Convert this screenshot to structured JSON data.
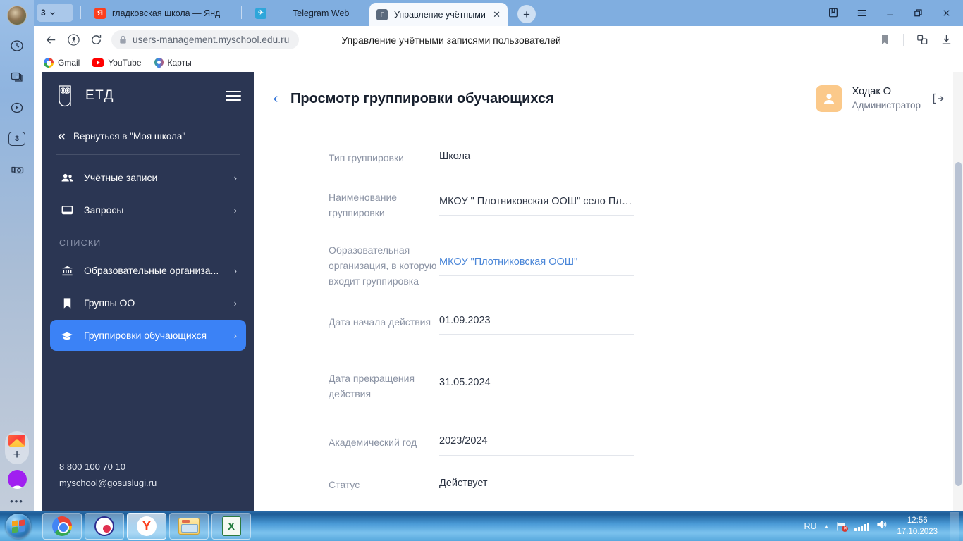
{
  "browser": {
    "tab_count": "3",
    "tabs": [
      {
        "id": "tab-yandex",
        "title": "гладковская школа — Янд",
        "favicon": "yandex-icon",
        "active": false
      },
      {
        "id": "tab-telegram",
        "title": "Telegram Web",
        "favicon": "telegram-icon",
        "active": false
      },
      {
        "id": "tab-gosuslugi",
        "title": "Управление учётными",
        "favicon": "gosuslugi-icon",
        "active": true
      }
    ],
    "new_tab_label": "+",
    "close_label": "✕",
    "address": "users-management.myschool.edu.ru",
    "document_title": "Управление учётными записями пользователей",
    "bookmarks": [
      {
        "label": "Gmail",
        "icon": "google-icon"
      },
      {
        "label": "YouTube",
        "icon": "youtube-icon"
      },
      {
        "label": "Карты",
        "icon": "maps-pin-icon"
      }
    ]
  },
  "sidepanel": {
    "items": [
      {
        "icon": "profile-avatar"
      },
      {
        "icon": "history-clock-icon"
      },
      {
        "icon": "notes-icon"
      },
      {
        "icon": "media-play-icon"
      },
      {
        "icon": "tab-count-icon",
        "badge": "3"
      },
      {
        "icon": "screenshot-camera-icon"
      }
    ],
    "bottom": [
      {
        "icon": "mail-icon"
      },
      {
        "icon": "add-plus-icon"
      },
      {
        "icon": "opera-icon"
      },
      {
        "icon": "more-dots-icon"
      }
    ]
  },
  "sidebar": {
    "logo_text": "ЕТД",
    "logo_icon": "owl-logo-icon",
    "menu_icon": "hamburger-icon",
    "back_link": "Вернуться в \"Моя школа\"",
    "back_icon": "double-chevron-left-icon",
    "items": [
      {
        "label": "Учётные записи",
        "icon": "people-icon",
        "active": false
      },
      {
        "label": "Запросы",
        "icon": "monitor-icon",
        "active": false
      }
    ],
    "group_title": "СПИСКИ",
    "list_items": [
      {
        "label": "Образовательные организа...",
        "icon": "bank-icon",
        "active": false
      },
      {
        "label": "Группы ОО",
        "icon": "bookmark-icon",
        "active": false
      },
      {
        "label": "Группировки обучающихся",
        "icon": "graduation-cap-icon",
        "active": true
      }
    ],
    "chevron": "›",
    "footer_phone": "8 800 100 70 10",
    "footer_email": "myschool@gosuslugi.ru"
  },
  "header": {
    "back_icon": "chevron-left-icon",
    "title": "Просмотр группировки обучающихся",
    "user_name": "Ходак О",
    "user_role": "Администратор",
    "avatar_icon": "user-avatar-icon",
    "logout_icon": "logout-icon"
  },
  "form": {
    "fields": [
      {
        "label": "Тип группировки",
        "value": "Школа",
        "link": false
      },
      {
        "label": "Наименование группировки",
        "value": "МКОУ \" Плотниковская ООШ\" село Пло...",
        "link": false
      },
      {
        "label": "Образовательная организация, в которую входит группировка",
        "value": "МКОУ \"Плотниковская ООШ\"",
        "link": true
      },
      {
        "label": "Дата начала действия",
        "value": "01.09.2023",
        "link": false
      },
      {
        "label": "Дата прекращения действия",
        "value": "31.05.2024",
        "link": false
      },
      {
        "label": "Академический год",
        "value": "2023/2024",
        "link": false
      },
      {
        "label": "Статус",
        "value": "Действует",
        "link": false
      }
    ]
  },
  "taskbar": {
    "start_label": "Пуск",
    "items": [
      {
        "name": "chrome",
        "icon": "chrome-icon",
        "active": false
      },
      {
        "name": "coreldraw",
        "icon": "coreldraw-icon",
        "active": false
      },
      {
        "name": "yandex-browser",
        "icon": "yandex-browser-icon",
        "active": true
      },
      {
        "name": "explorer",
        "icon": "folder-icon",
        "active": false
      },
      {
        "name": "excel",
        "icon": "excel-icon",
        "active": false
      }
    ],
    "language": "RU",
    "time": "12:56",
    "date": "17.10.2023",
    "tray_icons": [
      "network-warning-icon",
      "signal-icon",
      "volume-icon"
    ]
  },
  "colors": {
    "sidebar_bg": "#2b3653",
    "accent_blue": "#3b82f6",
    "link_blue": "#4a86d8",
    "tabstrip_blue": "#80aee0",
    "avatar_orange": "#fbc98a"
  }
}
